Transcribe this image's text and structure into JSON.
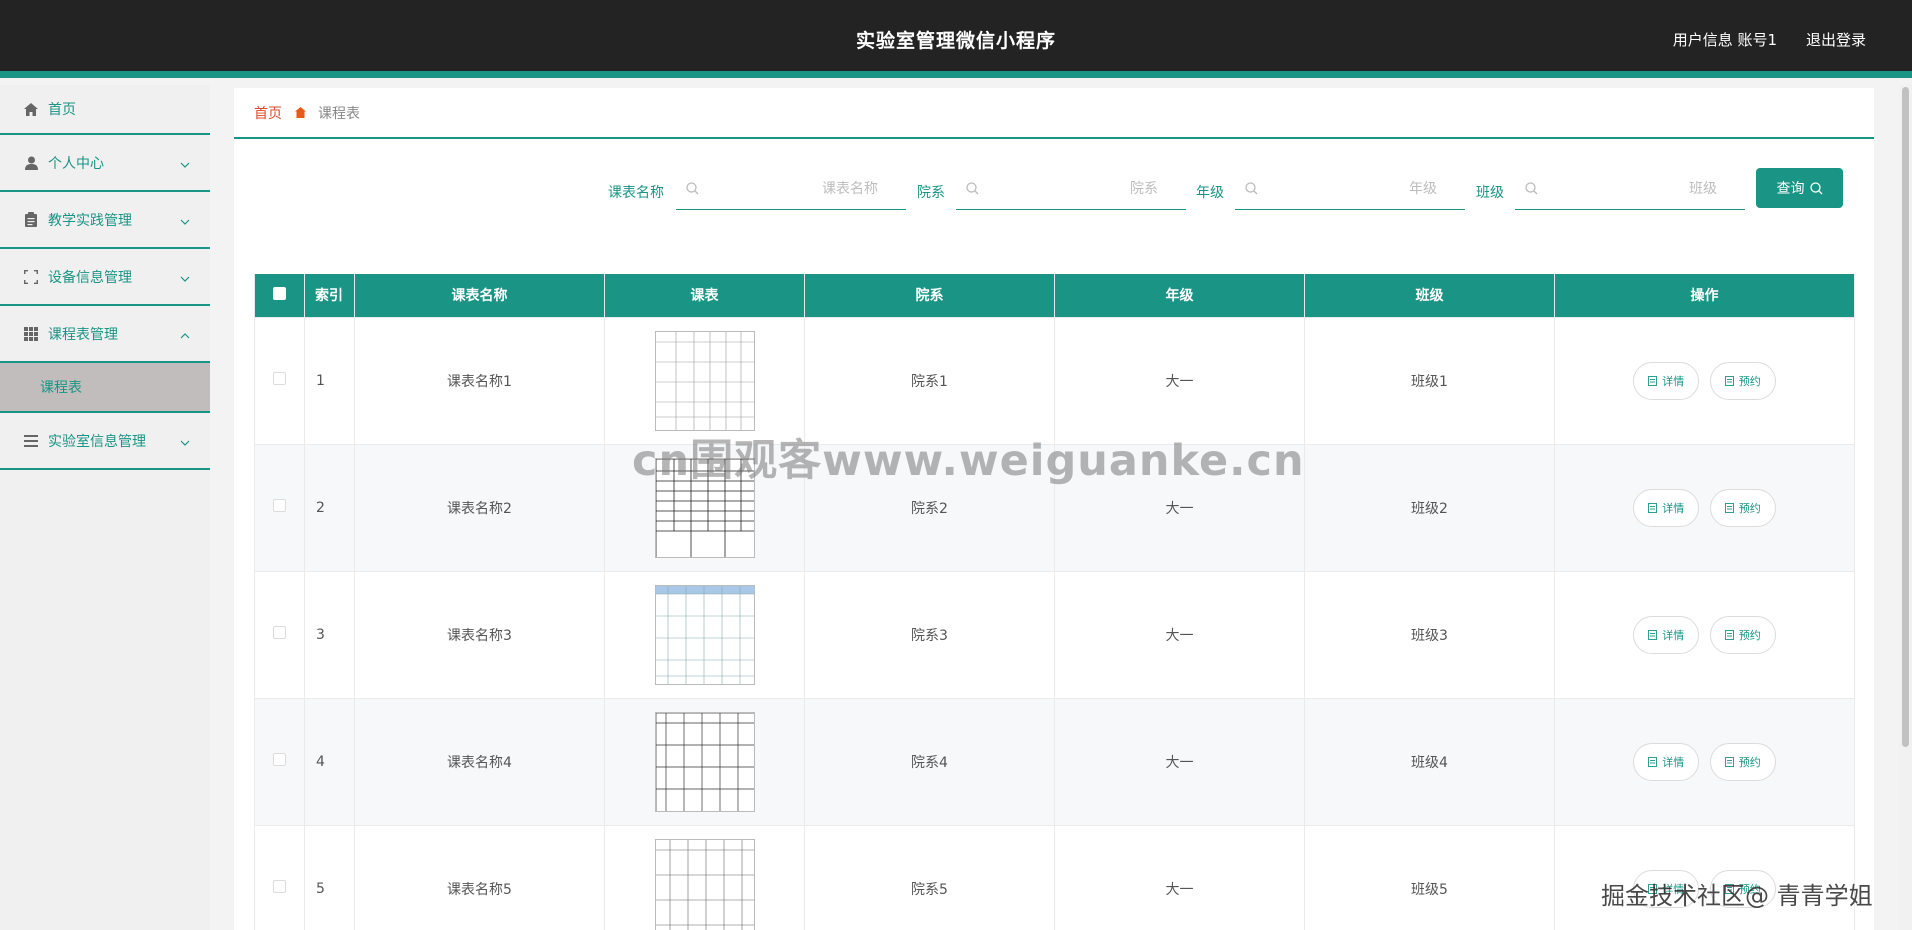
{
  "header": {
    "title": "实验室管理微信小程序",
    "user_info": "用户信息 账号1",
    "logout": "退出登录"
  },
  "sidebar": {
    "items": [
      {
        "label": "首页",
        "icon": "home-icon"
      },
      {
        "label": "个人中心",
        "icon": "user-icon"
      },
      {
        "label": "教学实践管理",
        "icon": "clipboard-icon"
      },
      {
        "label": "设备信息管理",
        "icon": "scan-icon"
      },
      {
        "label": "课程表管理",
        "icon": "grid-icon"
      },
      {
        "label": "实验室信息管理",
        "icon": "list-icon"
      }
    ],
    "subitem": "课程表"
  },
  "breadcrumb": {
    "home": "首页",
    "current": "课程表"
  },
  "search": {
    "fields": [
      {
        "label": "课表名称",
        "placeholder": "课表名称"
      },
      {
        "label": "院系",
        "placeholder": "院系"
      },
      {
        "label": "年级",
        "placeholder": "年级"
      },
      {
        "label": "班级",
        "placeholder": "班级"
      }
    ],
    "button": "查询"
  },
  "table": {
    "headers": [
      "索引",
      "课表名称",
      "课表",
      "院系",
      "年级",
      "班级",
      "操作"
    ],
    "rows": [
      {
        "index": "1",
        "name": "课表名称1",
        "dept": "院系1",
        "grade": "大一",
        "class": "班级1"
      },
      {
        "index": "2",
        "name": "课表名称2",
        "dept": "院系2",
        "grade": "大一",
        "class": "班级2"
      },
      {
        "index": "3",
        "name": "课表名称3",
        "dept": "院系3",
        "grade": "大一",
        "class": "班级3"
      },
      {
        "index": "4",
        "name": "课表名称4",
        "dept": "院系4",
        "grade": "大一",
        "class": "班级4"
      },
      {
        "index": "5",
        "name": "课表名称5",
        "dept": "院系5",
        "grade": "大一",
        "class": "班级5"
      }
    ],
    "detail_label": "详情",
    "reserve_label": "预约"
  },
  "overlays": {
    "watermark": "cn围观客www.weiguanke.cn",
    "corner": "掘金技术社区@ 青青学姐"
  },
  "colors": {
    "accent": "#1a9484",
    "header_bg": "#232323",
    "breadcrumb_home": "#e04a2a"
  }
}
